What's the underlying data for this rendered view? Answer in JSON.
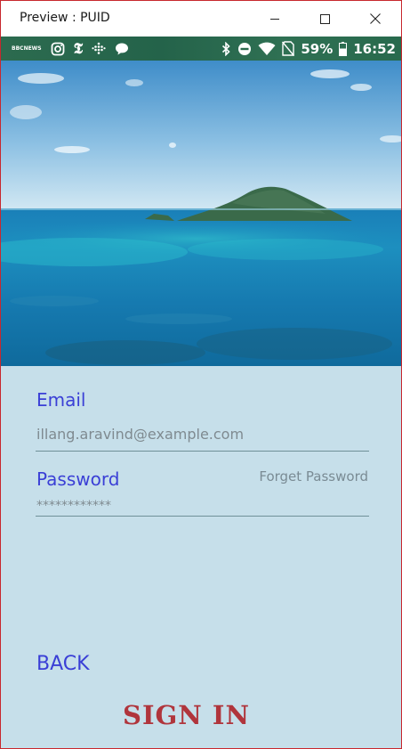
{
  "window": {
    "title": "Preview : PUID"
  },
  "status_bar": {
    "left_icons": [
      "bbc-news-icon",
      "instagram-icon",
      "nyt-icon",
      "dots-app-icon",
      "chat-bubble-icon"
    ],
    "bbc_line1": "BBC",
    "bbc_line2": "NEWS",
    "nyt_glyph": "𝕿",
    "right_icons": [
      "bluetooth-icon",
      "do-not-disturb-icon",
      "wifi-icon",
      "no-sim-icon"
    ],
    "battery": "59%",
    "time": "16:52"
  },
  "form": {
    "email_label": "Email",
    "email_value": "illang.aravind@example.com",
    "password_label": "Password",
    "password_value": "************",
    "forget_password": "Forget Password",
    "back_label": "BACK",
    "signin_label": "SIGN IN"
  },
  "colors": {
    "label_blue": "#3a3fd6",
    "signin_red": "#b0353c",
    "form_bg": "#c6dfea",
    "statusbar_green": "#2c6b4f"
  }
}
